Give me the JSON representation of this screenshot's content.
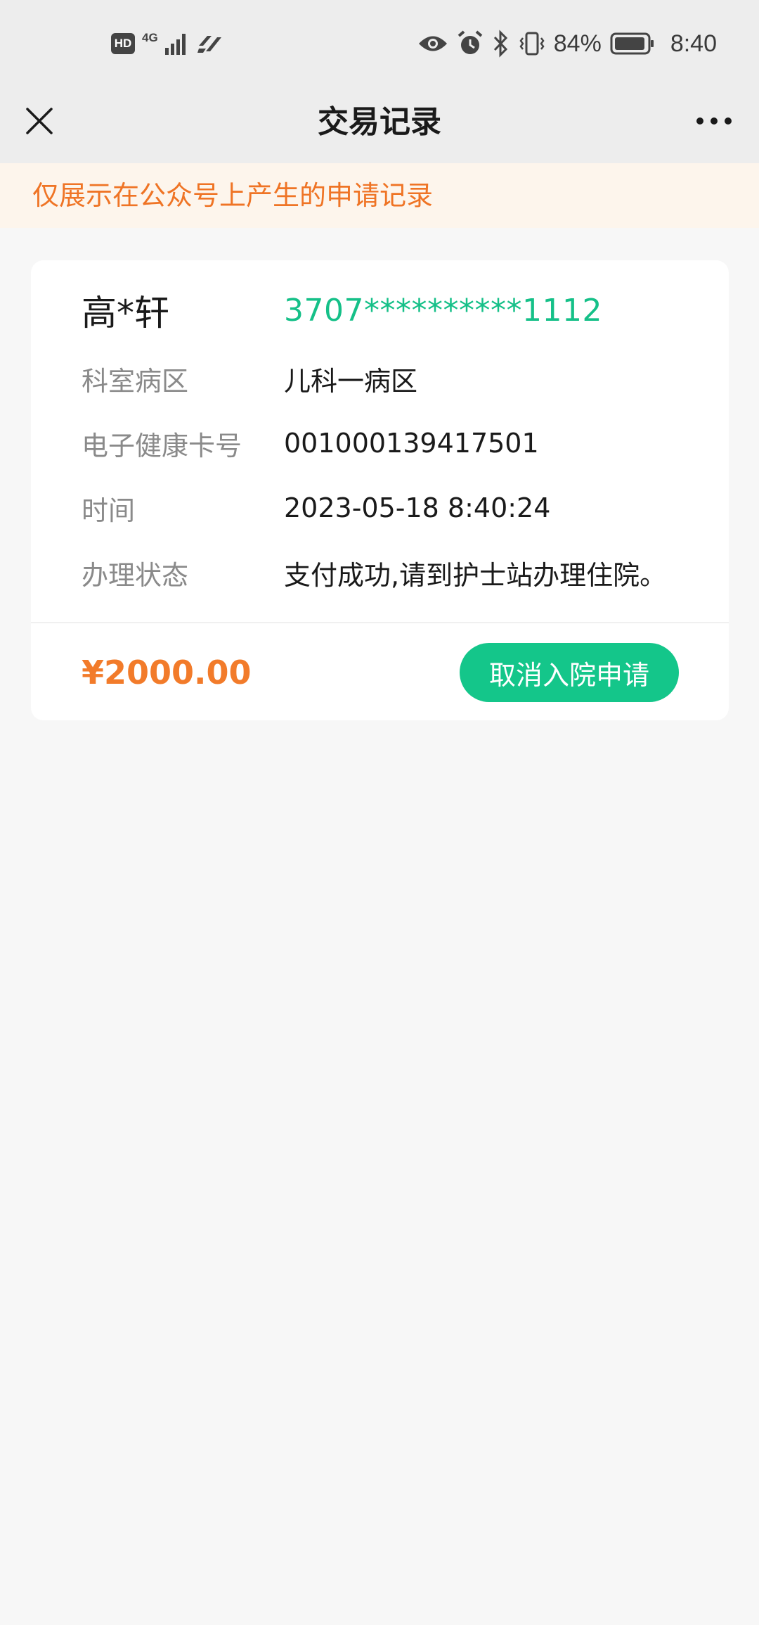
{
  "status_bar": {
    "hd_badge": "HD",
    "network": "4G",
    "battery_percent": "84%",
    "time": "8:40",
    "icons": [
      "hd-icon",
      "signal-icon",
      "wifi-calling-icon",
      "eye-icon",
      "alarm-icon",
      "bluetooth-icon",
      "vibrate-icon",
      "battery-icon"
    ]
  },
  "nav": {
    "title": "交易记录",
    "close_icon": "close-icon",
    "more_icon": "more-dots-icon"
  },
  "notice": {
    "text": "仅展示在公众号上产生的申请记录",
    "color": "#ef7425"
  },
  "record": {
    "patient_name": "高*轩",
    "patient_id": "3707**********1112",
    "fields": [
      {
        "label": "科室病区",
        "value": "儿科一病区"
      },
      {
        "label": "电子健康卡号",
        "value": "001000139417501"
      },
      {
        "label": "时间",
        "value": "2023-05-18 8:40:24"
      },
      {
        "label": "办理状态",
        "value": "支付成功,请到护士站办理住院。"
      }
    ],
    "amount": "¥2000.00",
    "cancel_button": "取消入院申请"
  },
  "colors": {
    "accent_green": "#14c68a",
    "accent_orange": "#f27b2a",
    "background": "#f7f7f7",
    "header": "#ededed"
  }
}
